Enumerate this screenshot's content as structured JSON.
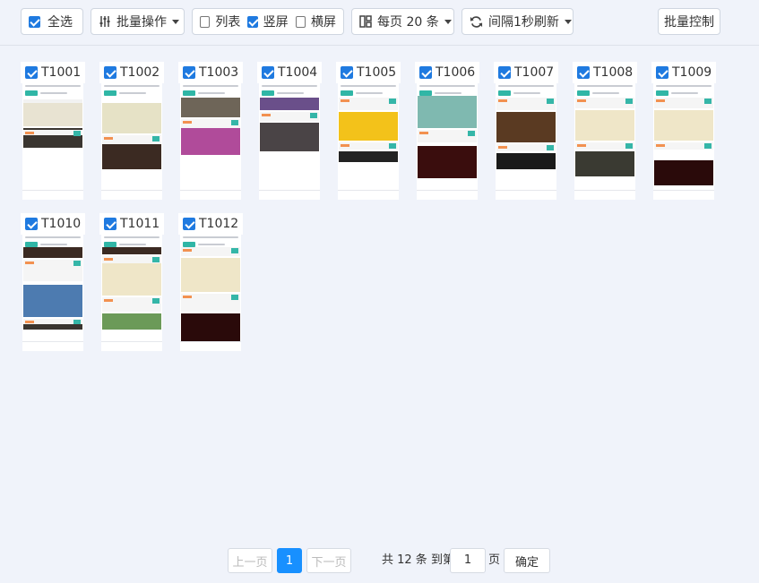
{
  "toolbar": {
    "select_all": {
      "label": "全选",
      "checked": true
    },
    "batch_ops": {
      "label": "批量操作"
    },
    "view_list": {
      "label": "列表",
      "checked": false
    },
    "view_portrait": {
      "label": "竖屏",
      "checked": true
    },
    "view_landscape": {
      "label": "横屏",
      "checked": false
    },
    "page_size": {
      "label": "每页 20 条"
    },
    "refresh": {
      "label": "间隔1秒刷新"
    },
    "batch_control": {
      "label": "批量控制"
    }
  },
  "devices": [
    {
      "id": "T1001",
      "checked": true,
      "theme": "a"
    },
    {
      "id": "T1002",
      "checked": true,
      "theme": "b"
    },
    {
      "id": "T1003",
      "checked": true,
      "theme": "c"
    },
    {
      "id": "T1004",
      "checked": true,
      "theme": "d"
    },
    {
      "id": "T1005",
      "checked": true,
      "theme": "e"
    },
    {
      "id": "T1006",
      "checked": true,
      "theme": "f"
    },
    {
      "id": "T1007",
      "checked": true,
      "theme": "g"
    },
    {
      "id": "T1008",
      "checked": true,
      "theme": "h"
    },
    {
      "id": "T1009",
      "checked": true,
      "theme": "h2"
    },
    {
      "id": "T1010",
      "checked": true,
      "theme": "i"
    },
    {
      "id": "T1011",
      "checked": true,
      "theme": "j"
    },
    {
      "id": "T1012",
      "checked": true,
      "theme": "k"
    }
  ],
  "pagination": {
    "prev_label": "上一页",
    "current_page": "1",
    "next_label": "下一页",
    "total_prefix": "共 12 条 到第",
    "goto_value": "1",
    "page_suffix": "页",
    "confirm_label": "确定"
  },
  "colors": {
    "accent": "#1f7ae0",
    "page_active": "#1890ff",
    "background": "#f0f3fa",
    "app_teal": "#30b6a6"
  }
}
